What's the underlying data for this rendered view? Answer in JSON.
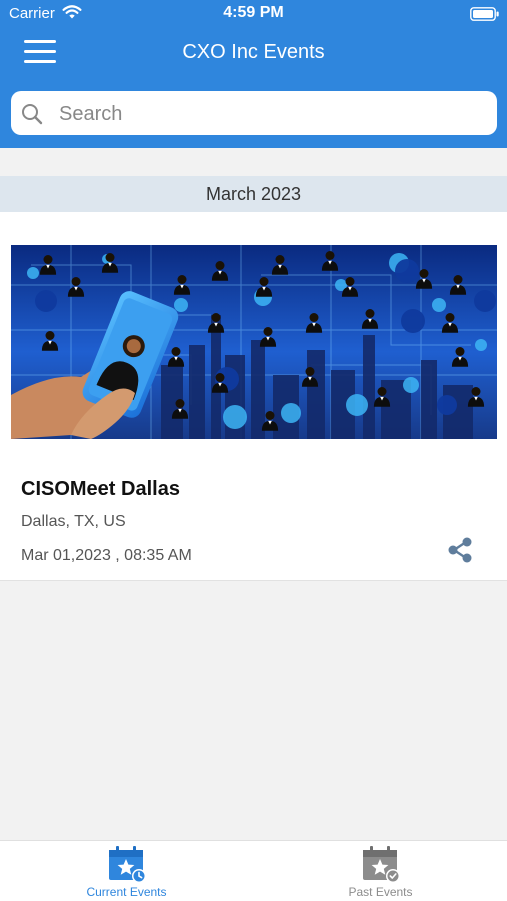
{
  "status_bar": {
    "carrier": "Carrier",
    "time": "4:59 PM"
  },
  "nav": {
    "title": "CXO Inc Events",
    "menu_icon": "hamburger-menu-icon"
  },
  "search": {
    "placeholder": "Search",
    "value": "",
    "icon": "search-icon"
  },
  "sections": [
    {
      "header": "March 2023",
      "events": [
        {
          "title": "CISOMeet Dallas",
          "location": "Dallas, TX, US",
          "datetime": "Mar 01,2023 , 08:35 AM",
          "share_icon": "share-icon"
        }
      ]
    }
  ],
  "tabs": [
    {
      "label": "Current Events",
      "icon": "calendar-star-clock-icon",
      "active": true
    },
    {
      "label": "Past Events",
      "icon": "calendar-star-check-icon",
      "active": false
    }
  ],
  "colors": {
    "primary": "#2f86dd",
    "section_header_bg": "#dde6ee",
    "background": "#f2f2f2",
    "inactive_tab": "#8c8c8c"
  }
}
